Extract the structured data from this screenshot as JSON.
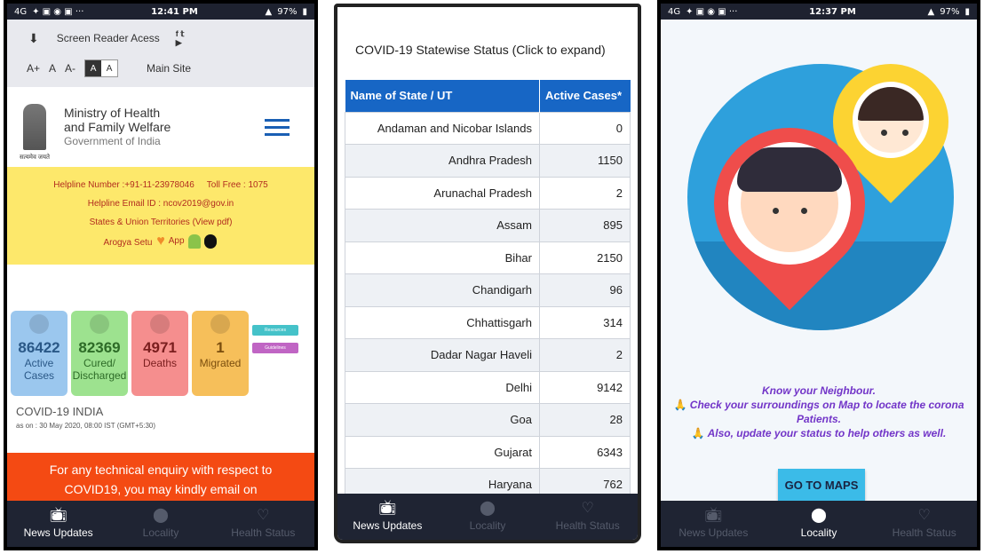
{
  "phone1": {
    "status": {
      "network": "4G",
      "time": "12:41 PM",
      "battery": "97%"
    },
    "access": {
      "screen_reader": "Screen Reader Acess",
      "font_plus": "A+",
      "font_normal": "A",
      "font_minus": "A-",
      "contrast_dark": "A",
      "contrast_light": "A",
      "main_site": "Main Site"
    },
    "ministry": {
      "line1": "Ministry of Health",
      "line2": "and Family Welfare",
      "line3": "Government of India",
      "emblem_caption": "सत्यमेव जयते"
    },
    "help": {
      "helpline": "Helpline Number :+91-11-23978046",
      "tollfree": "Toll Free : 1075",
      "email": "Helpline Email ID : ncov2019@gov.in",
      "states": "States & Union Territories (View pdf)",
      "arogya": "Arogya Setu",
      "app": "App"
    },
    "stats": [
      {
        "value": "86422",
        "label1": "Active",
        "label2": "Cases"
      },
      {
        "value": "82369",
        "label1": "Cured/",
        "label2": "Discharged"
      },
      {
        "value": "4971",
        "label1": "Deaths",
        "label2": ""
      },
      {
        "value": "1",
        "label1": "Migrated",
        "label2": ""
      }
    ],
    "mini_btn1": "Resources",
    "mini_btn2": "Guidelines",
    "india_title": "COVID-19 INDIA",
    "india_asof": "as on : 30 May 2020, 08:00 IST (GMT+5:30)",
    "enquiry": "For any technical enquiry with respect to COVID19, you may kindly email on",
    "nav": [
      "News Updates",
      "Locality",
      "Health Status"
    ]
  },
  "phone2": {
    "title": "COVID-19 Statewise Status (Click to expand)",
    "col_state": "Name of State / UT",
    "col_active": "Active Cases*",
    "rows": [
      {
        "state": "Andaman and Nicobar Islands",
        "active": "0"
      },
      {
        "state": "Andhra Pradesh",
        "active": "1150"
      },
      {
        "state": "Arunachal Pradesh",
        "active": "2"
      },
      {
        "state": "Assam",
        "active": "895"
      },
      {
        "state": "Bihar",
        "active": "2150"
      },
      {
        "state": "Chandigarh",
        "active": "96"
      },
      {
        "state": "Chhattisgarh",
        "active": "314"
      },
      {
        "state": "Dadar Nagar Haveli",
        "active": "2"
      },
      {
        "state": "Delhi",
        "active": "9142"
      },
      {
        "state": "Goa",
        "active": "28"
      },
      {
        "state": "Gujarat",
        "active": "6343"
      },
      {
        "state": "Haryana",
        "active": "762"
      }
    ],
    "nav": [
      "News Updates",
      "Locality",
      "Health Status"
    ]
  },
  "phone3": {
    "status": {
      "network": "4G",
      "time": "12:37 PM",
      "battery": "97%"
    },
    "know_title": "Know your Neighbour.",
    "know_line1": "Check your surroundings on Map to locate the corona Patients.",
    "know_line2": "Also, update your status to help others as well.",
    "go_maps": "GO TO MAPS",
    "nav": [
      "News Updates",
      "Locality",
      "Health Status"
    ]
  }
}
